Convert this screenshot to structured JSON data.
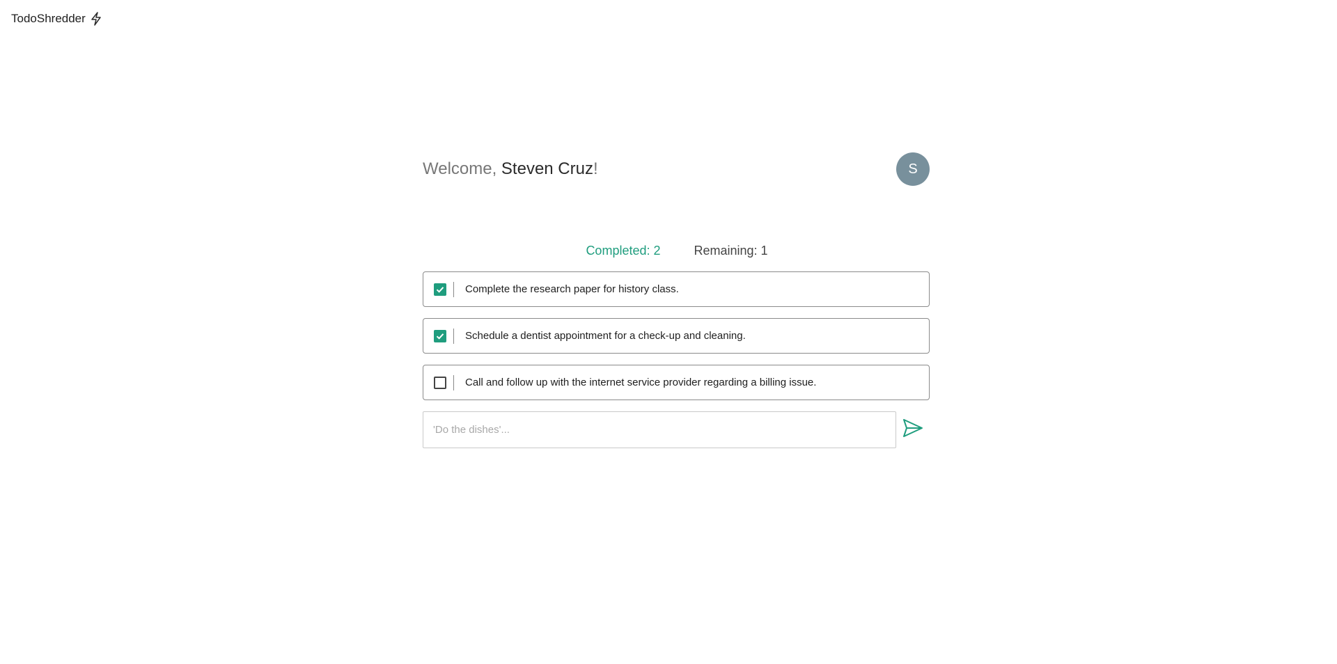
{
  "app": {
    "title": "TodoShredder",
    "logo_icon": "lightning-icon"
  },
  "header": {
    "greeting": "Welcome, ",
    "user_name": "Steven Cruz",
    "punctuation": "!",
    "avatar_initial": "S",
    "avatar_color": "#78909c"
  },
  "stats": {
    "completed_label": "Completed: 2",
    "remaining_label": "Remaining: 1"
  },
  "todos": [
    {
      "text": "Complete the research paper for history class.",
      "done": true
    },
    {
      "text": "Schedule a dentist appointment for a check-up and cleaning.",
      "done": true
    },
    {
      "text": "Call and follow up with the internet service provider regarding a billing issue.",
      "done": false
    }
  ],
  "new_todo": {
    "value": "",
    "placeholder": "'Do the dishes'...",
    "send_icon": "send-icon"
  },
  "colors": {
    "accent": "#1f9d7e",
    "border": "#8a8a8a"
  }
}
